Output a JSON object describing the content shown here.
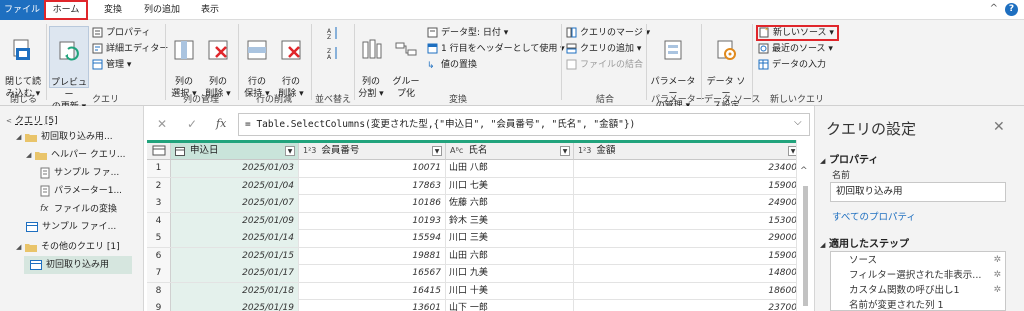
{
  "tabs": {
    "file": "ファイル",
    "home": "ホーム",
    "transform": "変換",
    "add_column": "列の追加",
    "view": "表示"
  },
  "ribbon": {
    "close": {
      "close_load": "閉じて読\nみ込む ▾",
      "group": "閉じる"
    },
    "query": {
      "refresh_preview": "プレビュー\nの更新 ▾",
      "properties": "プロパティ",
      "advanced_editor": "詳細エディター",
      "manage": "管理 ▾",
      "group": "クエリ"
    },
    "manage_columns": {
      "choose": "列の\n選択 ▾",
      "remove": "列の\n削除 ▾",
      "group": "列の管理"
    },
    "reduce_rows": {
      "keep": "行の\n保持 ▾",
      "remove": "行の\n削除 ▾",
      "group": "行の削減"
    },
    "sort": {
      "group": "並べ替え"
    },
    "transform": {
      "split": "列の\n分割 ▾",
      "group_by": "グルー\nプ化",
      "data_type": "データ型: 日付 ▾",
      "first_row_header": "1 行目をヘッダーとして使用 ▾",
      "replace_values": "値の置換",
      "group": "変換"
    },
    "combine": {
      "merge": "クエリのマージ ▾",
      "append": "クエリの追加 ▾",
      "combine_files": "ファイルの結合",
      "group": "結合"
    },
    "parameters": {
      "manage": "パラメーター\nの管理 ▾",
      "group": "パラメーター"
    },
    "data_source": {
      "settings": "データ ソー\nス設定",
      "group": "データ ソース"
    },
    "new_query": {
      "new_source": "新しいソース ▾",
      "recent_sources": "最近のソース ▾",
      "enter_data": "データの入力",
      "group": "新しいクエリ"
    }
  },
  "formula": {
    "text": "= Table.SelectColumns(変更された型,{\"申込日\", \"会員番号\", \"氏名\", \"金額\"})",
    "fx": "fx"
  },
  "queries_pane": {
    "title": "クエリ [5]",
    "items": [
      {
        "label": "初回取り込み用..."
      },
      {
        "label": "ヘルパー クエリ..."
      },
      {
        "label": "サンプル ファ..."
      },
      {
        "label": "パラメーター1..."
      },
      {
        "label": "ファイルの変換"
      },
      {
        "label": "サンプル ファイ..."
      },
      {
        "label": "その他のクエリ [1]"
      },
      {
        "label": "初回取り込み用"
      }
    ]
  },
  "table": {
    "columns": [
      {
        "type": "date",
        "name": "申込日"
      },
      {
        "type": "1²3",
        "name": "会員番号"
      },
      {
        "type": "Aᴮc",
        "name": "氏名"
      },
      {
        "type": "1²3",
        "name": "金額"
      }
    ],
    "rows": [
      {
        "n": "1",
        "date": "2025/01/03",
        "member": "10071",
        "name": "山田 八郎",
        "amount": "23400"
      },
      {
        "n": "2",
        "date": "2025/01/04",
        "member": "17863",
        "name": "川口 七美",
        "amount": "15900"
      },
      {
        "n": "3",
        "date": "2025/01/07",
        "member": "10186",
        "name": "佐藤 六郎",
        "amount": "24900"
      },
      {
        "n": "4",
        "date": "2025/01/09",
        "member": "10193",
        "name": "鈴木 三美",
        "amount": "15300"
      },
      {
        "n": "5",
        "date": "2025/01/14",
        "member": "15594",
        "name": "川口 三美",
        "amount": "29000"
      },
      {
        "n": "6",
        "date": "2025/01/15",
        "member": "19881",
        "name": "山田 六郎",
        "amount": "15900"
      },
      {
        "n": "7",
        "date": "2025/01/17",
        "member": "16567",
        "name": "川口 九美",
        "amount": "14800"
      },
      {
        "n": "8",
        "date": "2025/01/18",
        "member": "16415",
        "name": "川口 十美",
        "amount": "18600"
      },
      {
        "n": "9",
        "date": "2025/01/19",
        "member": "13601",
        "name": "山下 一郎",
        "amount": "23700"
      }
    ]
  },
  "settings_pane": {
    "title": "クエリの設定",
    "properties_heading": "プロパティ",
    "name_label": "名前",
    "name_value": "初回取り込み用",
    "all_properties": "すべてのプロパティ",
    "steps_heading": "適用したステップ",
    "steps": [
      {
        "label": "ソース"
      },
      {
        "label": "フィルター選択された非表示..."
      },
      {
        "label": "カスタム関数の呼び出し1"
      },
      {
        "label": "名前が変更された列 1"
      }
    ]
  },
  "colors": {
    "accent": "#1e6fc0",
    "highlight_box": "#e0262b",
    "selected_column": "#e4f1ec",
    "header_bar": "#21a37c"
  }
}
